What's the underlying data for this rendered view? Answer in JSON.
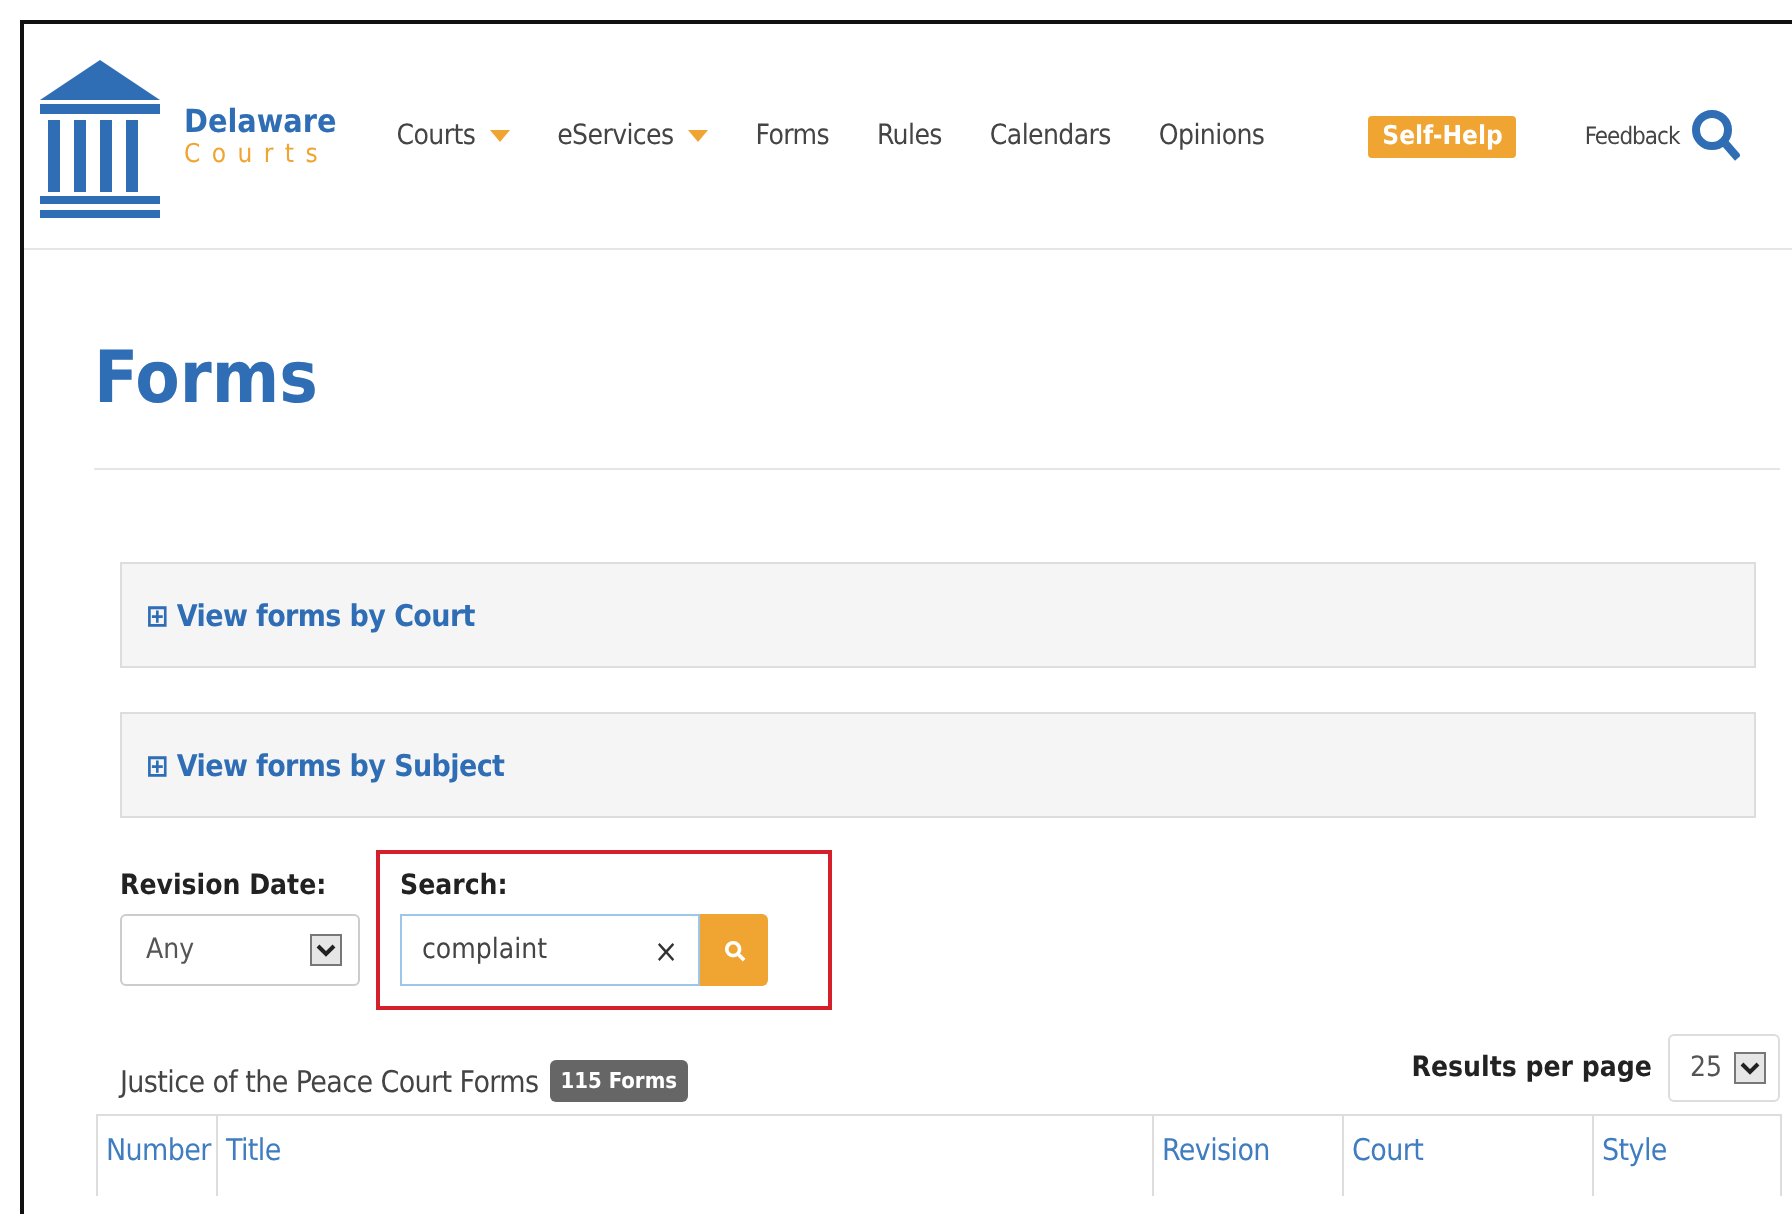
{
  "logo": {
    "line1": "Delaware",
    "line2": "C o u r t s"
  },
  "nav": [
    {
      "label": "Courts",
      "dropdown": true
    },
    {
      "label": "eServices",
      "dropdown": true
    },
    {
      "label": "Forms",
      "dropdown": false
    },
    {
      "label": "Rules",
      "dropdown": false
    },
    {
      "label": "Calendars",
      "dropdown": false
    },
    {
      "label": "Opinions",
      "dropdown": false
    }
  ],
  "self_help": "Self-Help",
  "feedback": "Feedback",
  "page_title": "Forms",
  "accordions": [
    {
      "icon": "⊞",
      "label": "View forms by Court"
    },
    {
      "icon": "⊞",
      "label": "View forms by Subject"
    }
  ],
  "revision_date": {
    "label": "Revision Date:",
    "value": "Any"
  },
  "search": {
    "label": "Search:",
    "value": "complaint",
    "clear": "×"
  },
  "results": {
    "title": "Justice of the Peace Court Forms",
    "count": "115 Forms",
    "per_page_label": "Results per page",
    "per_page": "25"
  },
  "table": {
    "columns": [
      "Number",
      "Title",
      "Revision",
      "Court",
      "Style"
    ]
  }
}
